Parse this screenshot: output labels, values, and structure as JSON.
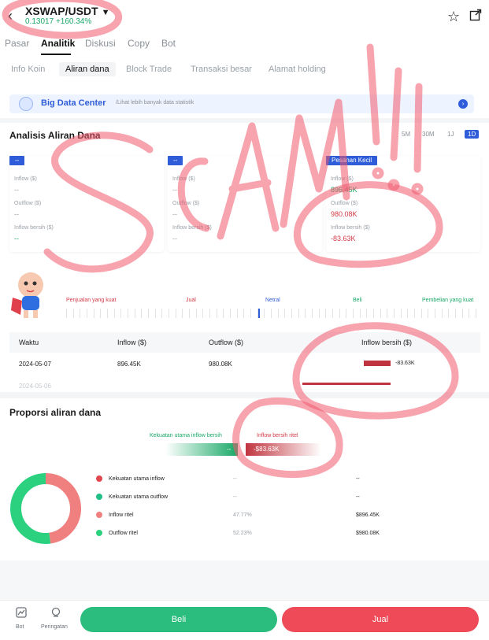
{
  "header": {
    "back_icon": "chevron-left-icon",
    "pair": "XSWAP/USDT",
    "caret": "▼",
    "price": "0.13017",
    "change": "+160.34%",
    "star_icon": "star-icon",
    "share_icon": "share-icon"
  },
  "tabs": [
    "Pasar",
    "Analitik",
    "Diskusi",
    "Copy",
    "Bot"
  ],
  "subtabs": [
    "Info Koin",
    "Aliran dana",
    "Block Trade",
    "Transaksi besar",
    "Alamat holding"
  ],
  "bigdata": {
    "title": "Big Data Center",
    "subtitle": "/Lihat lebih banyak data statistik"
  },
  "analysis": {
    "title": "Analisis Aliran Dana",
    "periods": [
      "5M",
      "30M",
      "1J",
      "1D"
    ],
    "active_period": "1D",
    "cards": [
      {
        "chip": "--",
        "inflow_label": "Inflow ($)",
        "inflow": "--",
        "outflow_label": "Outflow ($)",
        "outflow": "--",
        "net_label": "Inflow bersih ($)",
        "net": "--"
      },
      {
        "chip": "--",
        "inflow_label": "Inflow ($)",
        "inflow": "--",
        "outflow_label": "Outflow ($)",
        "outflow": "--",
        "net_label": "Inflow bersih ($)",
        "net": "--"
      },
      {
        "chip": "Pesanan Kecil",
        "inflow_label": "Inflow ($)",
        "inflow": "896.45K",
        "outflow_label": "Outflow ($)",
        "outflow": "980.08K",
        "net_label": "Inflow bersih ($)",
        "net": "-83.63K"
      }
    ]
  },
  "sentiment": {
    "labels": [
      "Penjualan yang kuat",
      "Jual",
      "Netral",
      "Beli",
      "Pembelian yang kuat"
    ],
    "level": 0.47
  },
  "table": {
    "headers": [
      "Waktu",
      "Inflow ($)",
      "Outflow ($)",
      "Inflow bersih ($)"
    ],
    "rows": [
      {
        "date": "2024-05-07",
        "inflow": "896.45K",
        "outflow": "980.08K",
        "net": "-83.63K"
      },
      {
        "date": "2024-05-06",
        "inflow": "--",
        "outflow": "--",
        "net": "--"
      }
    ]
  },
  "proportion": {
    "title": "Proporsi aliran dana",
    "left_label": "Kekuatan utama inflow bersih",
    "right_label": "Inflow bersih ritel",
    "left_value": "--",
    "right_value": "-$83.63K",
    "legend": [
      {
        "label": "Kekuatan utama inflow",
        "pct": "--",
        "amount": "--",
        "color": "#e2474f"
      },
      {
        "label": "Kekuatan utama outflow",
        "pct": "--",
        "amount": "--",
        "color": "#1fbf86"
      },
      {
        "label": "Inflow ritel",
        "pct": "47.77%",
        "amount": "$896.45K",
        "color": "#f08080"
      },
      {
        "label": "Outflow ritel",
        "pct": "52.23%",
        "amount": "$980.08K",
        "color": "#2bd17f"
      }
    ]
  },
  "bottom": {
    "bot_label": "Bot",
    "alert_label": "Peringatan",
    "buy": "Beli",
    "sell": "Jual"
  },
  "colors": {
    "brand": "#2f5cd8",
    "up": "#18a866",
    "down": "#d43a45",
    "buy_button": "#2bbd7e",
    "sell_button": "#ee4a57",
    "scribble": "#f05a6e"
  }
}
